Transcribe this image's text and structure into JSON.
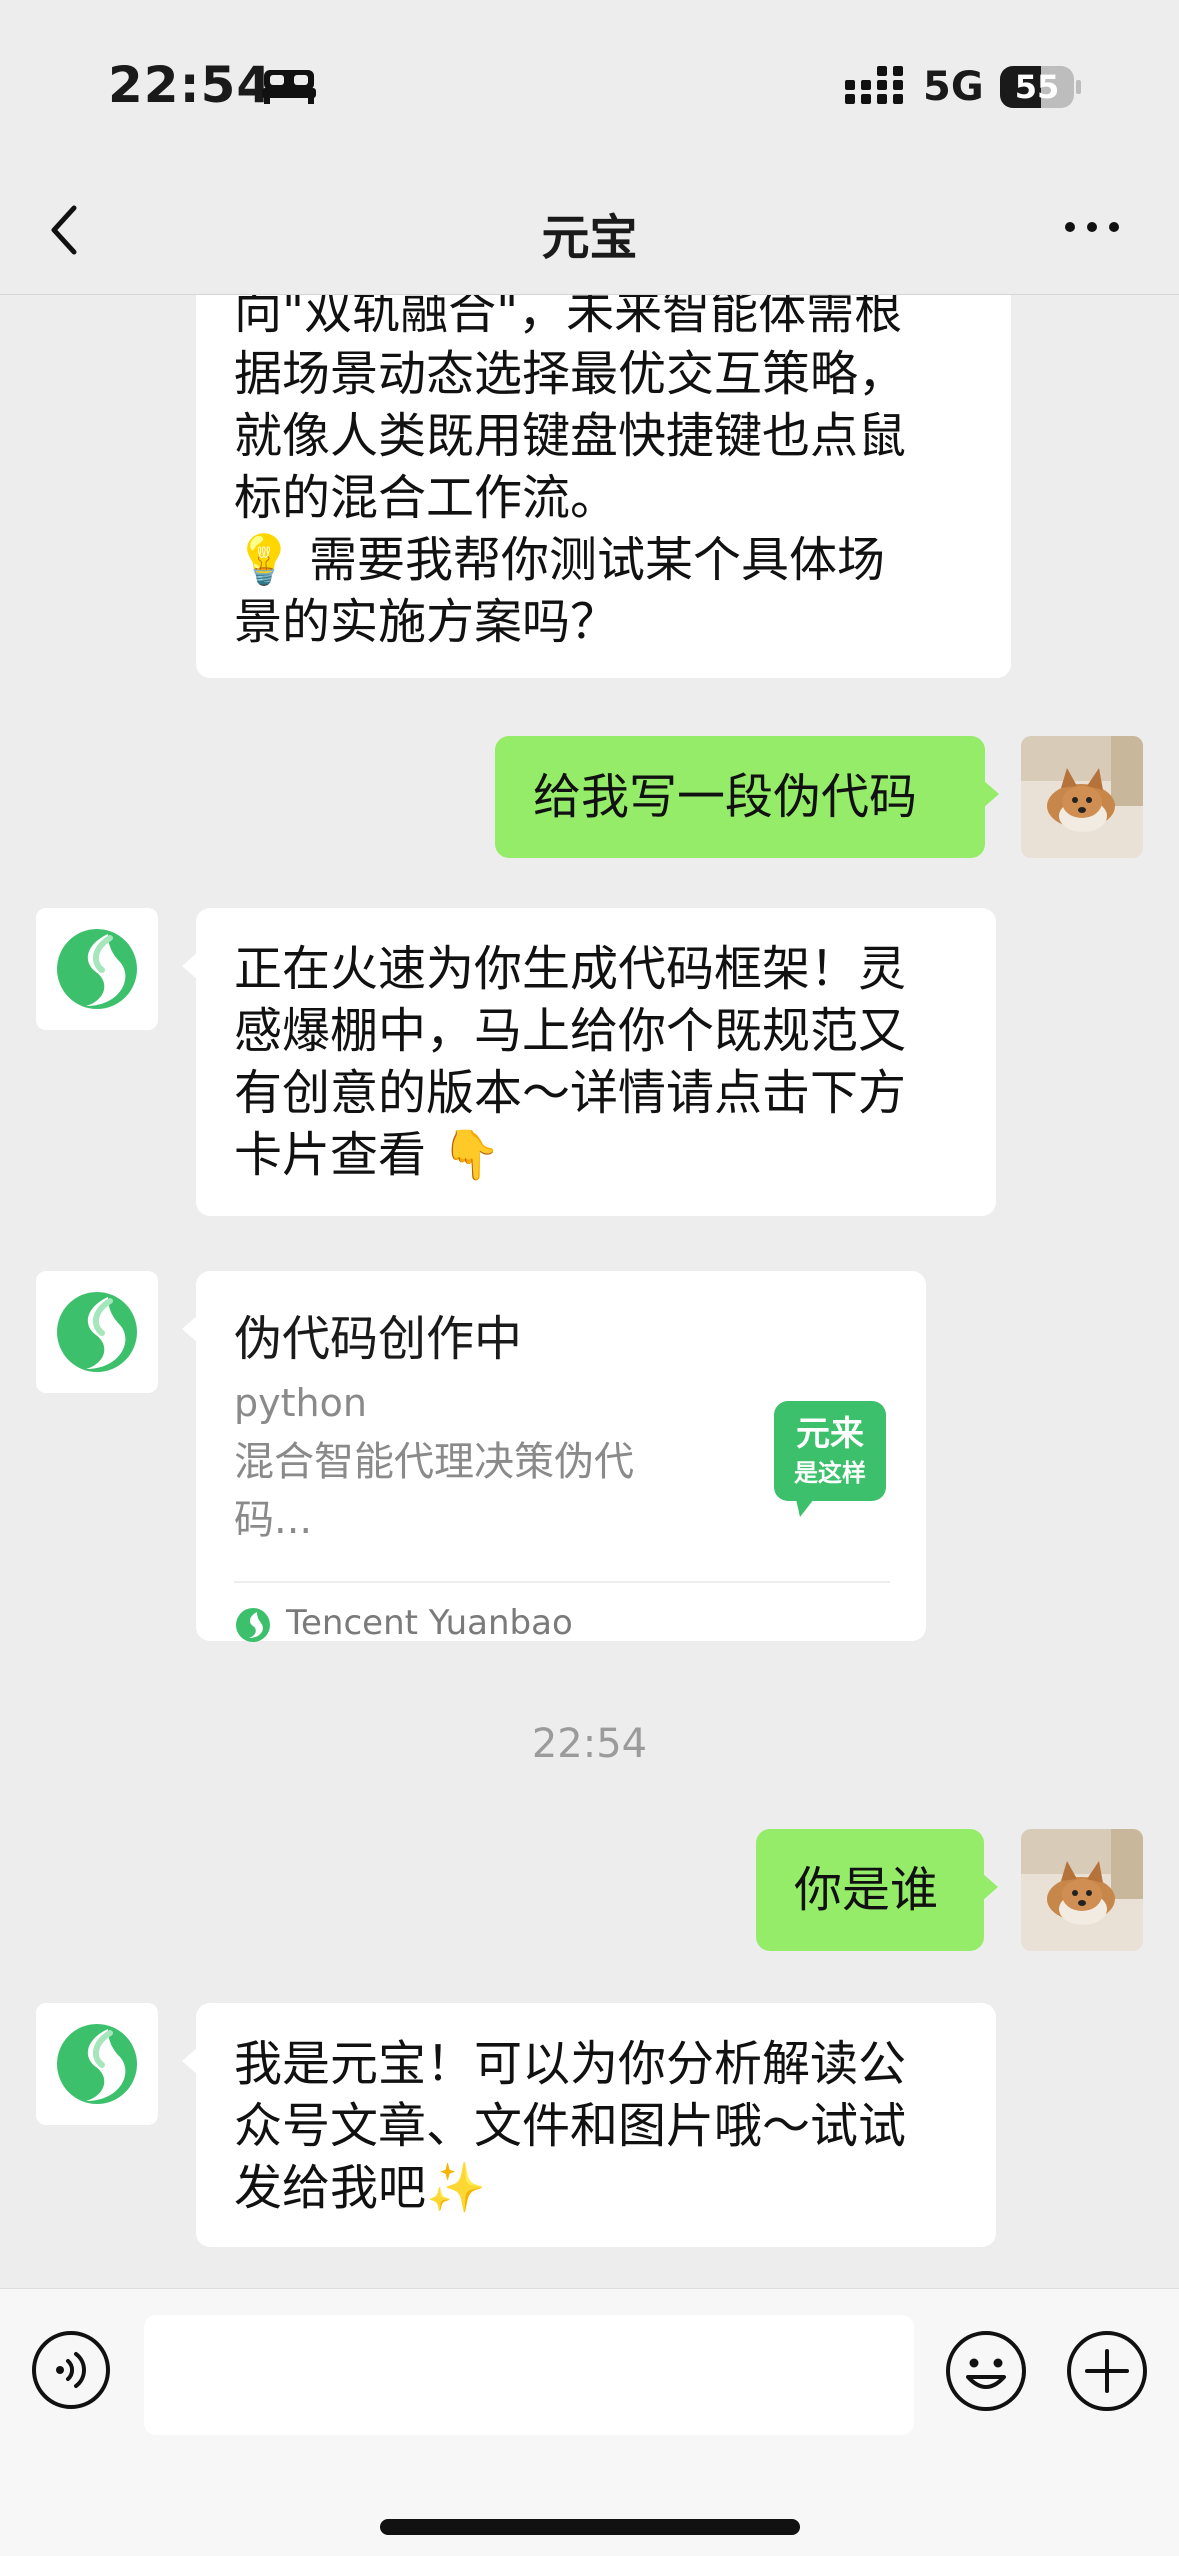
{
  "status_bar": {
    "time": "22:54",
    "network": "5G",
    "battery": "55",
    "battery_level": 0.55,
    "icons": [
      "sleep-bed-icon",
      "cellular-signal-icon",
      "battery-icon"
    ]
  },
  "nav": {
    "title": "元宝",
    "icons": [
      "chevron-left-icon",
      "more-dots-icon"
    ]
  },
  "messages": [
    {
      "sender": "bot",
      "lines": [
        "向\"双轨融合\"，未来智能体需根",
        "据场景动态选择最优交互策略，",
        "就像人类既用键盘快捷键也点鼠",
        "标的混合工作流。",
        "💡 需要我帮你测试某个具体场",
        "景的实施方案吗？"
      ]
    },
    {
      "sender": "me",
      "text": "给我写一段伪代码"
    },
    {
      "sender": "bot",
      "lines": [
        "正在火速为你生成代码框架！灵",
        "感爆棚中，马上给你个既规范又",
        "有创意的版本～详情请点击下方",
        "卡片查看 👇"
      ]
    },
    {
      "sender": "bot",
      "card": {
        "title": "伪代码创作中",
        "language": "python",
        "desc_lines": [
          "混合智能代理决策伪代",
          "码..."
        ],
        "thumb_line1": "元来",
        "thumb_line2": "是这样",
        "source": "Tencent Yuanbao"
      }
    },
    {
      "timestamp": "22:54"
    },
    {
      "sender": "me",
      "text": "你是谁"
    },
    {
      "sender": "bot",
      "lines": [
        "我是元宝！可以为你分析解读公",
        "众号文章、文件和图片哦～试试",
        "发给我吧✨"
      ]
    }
  ],
  "input_bar": {
    "placeholder": "",
    "icons": [
      "voice-icon",
      "emoji-icon",
      "plus-icon"
    ]
  },
  "colors": {
    "background": "#ededed",
    "my_bubble": "#95ec69",
    "bot_bubble": "#ffffff",
    "brand_green": "#3cc06c"
  }
}
